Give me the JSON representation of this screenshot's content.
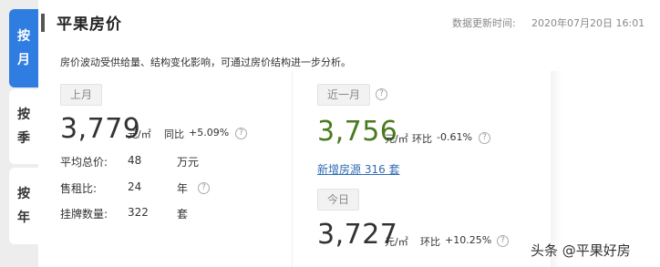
{
  "tabs": [
    {
      "chars": [
        "按",
        "月"
      ],
      "active": true
    },
    {
      "chars": [
        "按",
        "季"
      ],
      "active": false
    },
    {
      "chars": [
        "按",
        "年"
      ],
      "active": false
    }
  ],
  "header": {
    "title": "平果房价",
    "update_label": "数据更新时间:",
    "update_time": "2020年07月20日 16:01"
  },
  "description": "房价波动受供给量、结构变化影响，可通过房价结构进一步分析。",
  "last_month": {
    "label": "上月",
    "price": "3,779",
    "unit": "元/㎡",
    "change_label": "同比",
    "change": "+5.09%",
    "rows": [
      {
        "label": "平均总价:",
        "value": "48",
        "unit": "万元"
      },
      {
        "label": "售租比:",
        "value": "24",
        "unit": "年"
      },
      {
        "label": "挂牌数量:",
        "value": "322",
        "unit": "套"
      }
    ]
  },
  "recent_month": {
    "label": "近一月",
    "price": "3,756",
    "unit": "元/㎡",
    "change_label": "环比",
    "change": "-0.61%",
    "new_listings": "新增房源 316 套"
  },
  "today": {
    "label": "今日",
    "price": "3,727",
    "unit": "元/㎡",
    "change_label": "环比",
    "change": "+10.25%"
  },
  "help_icon": "?",
  "watermark": "头条 @平果好房",
  "colors": {
    "accent": "#2f7de1",
    "green": "#4a7a1e",
    "link": "#2f6db5"
  }
}
